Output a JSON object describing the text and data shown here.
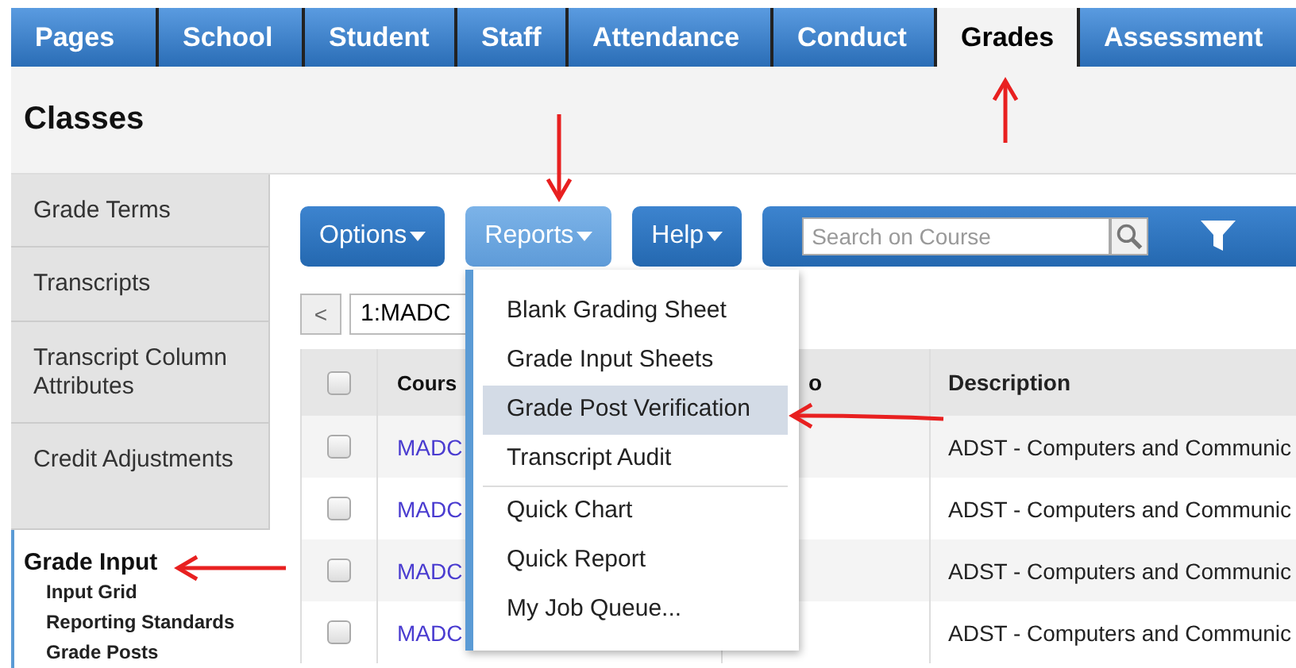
{
  "tabs": [
    {
      "label": "Pages",
      "selected": false
    },
    {
      "label": "School",
      "selected": false
    },
    {
      "label": "Student",
      "selected": false
    },
    {
      "label": "Staff",
      "selected": false
    },
    {
      "label": "Attendance",
      "selected": false
    },
    {
      "label": "Conduct",
      "selected": false
    },
    {
      "label": "Grades",
      "selected": true
    },
    {
      "label": "Assessment",
      "selected": false
    }
  ],
  "page_title": "Classes",
  "sidebar": {
    "items": [
      {
        "label": "Grade Terms"
      },
      {
        "label": "Transcripts"
      },
      {
        "label": "Transcript Column Attributes"
      },
      {
        "label": "Credit Adjustments"
      }
    ],
    "current": {
      "label": "Grade Input",
      "children": [
        {
          "label": "Input Grid"
        },
        {
          "label": "Reporting Standards"
        },
        {
          "label": "Grade Posts"
        }
      ]
    }
  },
  "toolbar": {
    "buttons": [
      {
        "label": "Options",
        "open": false
      },
      {
        "label": "Reports",
        "open": true
      },
      {
        "label": "Help",
        "open": false
      }
    ],
    "search": {
      "placeholder": "Search on Course"
    }
  },
  "navigator": {
    "prev": "<",
    "value": "1:MADC"
  },
  "table": {
    "all_checked": false,
    "columns": [
      "Cours",
      "o",
      "Description"
    ],
    "rows": [
      {
        "checked": false,
        "course": "MADC",
        "description": "ADST - Computers and Communic"
      },
      {
        "checked": false,
        "course": "MADC",
        "description": "ADST - Computers and Communic"
      },
      {
        "checked": false,
        "course": "MADC",
        "description": "ADST - Computers and Communic"
      },
      {
        "checked": false,
        "course": "MADC",
        "description": "ADST - Computers and Communic"
      }
    ]
  },
  "reports_menu": {
    "groups": [
      [
        {
          "label": "Blank Grading Sheet",
          "selected": false
        },
        {
          "label": "Grade Input Sheets",
          "selected": false
        },
        {
          "label": "Grade Post Verification",
          "selected": true
        },
        {
          "label": "Transcript Audit",
          "selected": false
        }
      ],
      [
        {
          "label": "Quick Chart",
          "selected": false
        },
        {
          "label": "Quick Report",
          "selected": false
        },
        {
          "label": "My Job Queue...",
          "selected": false
        }
      ]
    ]
  }
}
